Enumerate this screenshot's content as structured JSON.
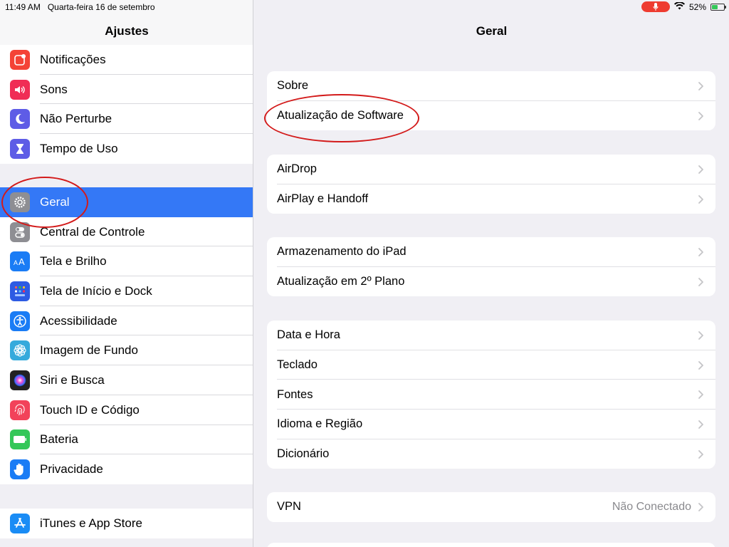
{
  "status": {
    "time": "11:49 AM",
    "date": "Quarta-feira 16 de setembro",
    "battery": "52%",
    "battery_level": 0.52
  },
  "sidebar": {
    "title": "Ajustes",
    "group1": [
      {
        "label": "Notificações",
        "icon": "notifications-icon",
        "color": "#f44336"
      },
      {
        "label": "Sons",
        "icon": "sounds-icon",
        "color": "#f02d55"
      },
      {
        "label": "Não Perturbe",
        "icon": "moon-icon",
        "color": "#5e5ce6"
      },
      {
        "label": "Tempo de Uso",
        "icon": "hourglass-icon",
        "color": "#5e5ce6"
      }
    ],
    "group2": [
      {
        "label": "Geral",
        "icon": "gear-icon",
        "color": "#8e8e93",
        "selected": true
      },
      {
        "label": "Central de Controle",
        "icon": "toggles-icon",
        "color": "#8e8e93"
      },
      {
        "label": "Tela e Brilho",
        "icon": "text-size-icon",
        "color": "#1a7cf5"
      },
      {
        "label": "Tela de Início e Dock",
        "icon": "home-grid-icon",
        "color": "#2d5be3"
      },
      {
        "label": "Acessibilidade",
        "icon": "accessibility-icon",
        "color": "#1a7cf5"
      },
      {
        "label": "Imagem de Fundo",
        "icon": "flower-icon",
        "color": "#35aadc"
      },
      {
        "label": "Siri e Busca",
        "icon": "siri-icon",
        "color": "#222222"
      },
      {
        "label": "Touch ID e Código",
        "icon": "fingerprint-icon",
        "color": "#f2425a"
      },
      {
        "label": "Bateria",
        "icon": "battery-icon",
        "color": "#34c759"
      },
      {
        "label": "Privacidade",
        "icon": "hand-icon",
        "color": "#1a7cf5"
      }
    ],
    "group3": [
      {
        "label": "iTunes e App Store",
        "icon": "app-store-icon",
        "color": "#1a8cf5"
      }
    ]
  },
  "main": {
    "title": "Geral",
    "cards": [
      [
        {
          "label": "Sobre"
        },
        {
          "label": "Atualização de Software"
        }
      ],
      [
        {
          "label": "AirDrop"
        },
        {
          "label": "AirPlay e Handoff"
        }
      ],
      [
        {
          "label": "Armazenamento do iPad"
        },
        {
          "label": "Atualização em 2º Plano"
        }
      ],
      [
        {
          "label": "Data e Hora"
        },
        {
          "label": "Teclado"
        },
        {
          "label": "Fontes"
        },
        {
          "label": "Idioma e Região"
        },
        {
          "label": "Dicionário"
        }
      ],
      [
        {
          "label": "VPN",
          "value": "Não Conectado"
        }
      ]
    ]
  }
}
